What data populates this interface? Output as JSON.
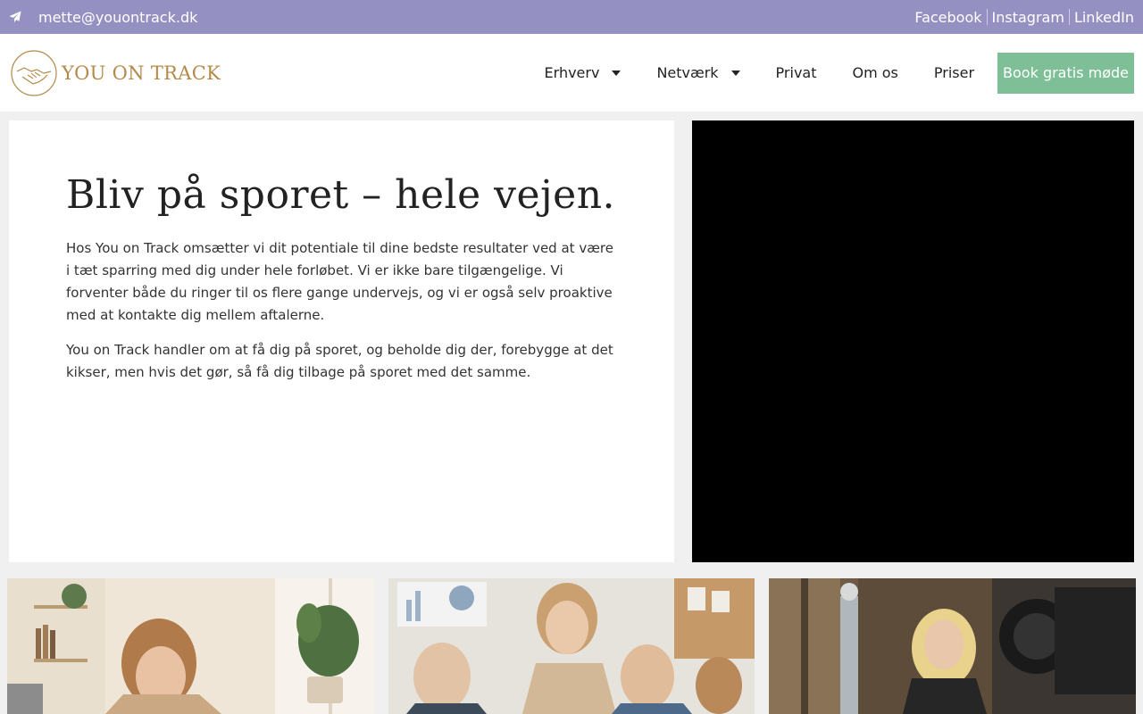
{
  "topbar": {
    "email": "mette@youontrack.dk",
    "socials": [
      "Facebook",
      "Instagram",
      "LinkedIn"
    ],
    "background": "#9590c2"
  },
  "logo": {
    "text": "YOU ON TRACK",
    "icon": "handshake-icon"
  },
  "nav": {
    "items": [
      {
        "label": "Erhverv",
        "dropdown": true
      },
      {
        "label": "Netværk",
        "dropdown": true
      },
      {
        "label": "Privat",
        "dropdown": false
      },
      {
        "label": "Om os",
        "dropdown": false
      },
      {
        "label": "Priser",
        "dropdown": false
      }
    ],
    "cta": "Book gratis møde",
    "cta_color": "#7fbf98"
  },
  "hero": {
    "title": "Bliv på sporet – hele vejen.",
    "paragraphs": [
      "Hos You on Track omsætter vi dit potentiale til dine bedste resultater ved at være i tæt sparring med dig under hele forløbet. Vi er ikke bare tilgængelige. Vi forventer både du ringer til os flere gange undervejs, og vi er også selv proaktive med at kontakte dig mellem aftalerne.",
      "You on Track handler om at få dig på sporet, og beholde dig der, forebygge at det kikser, men hvis det gør, så få dig tilbage på sporet med det samme."
    ]
  },
  "accent_colors": {
    "gold": "#b48a4a",
    "purple": "#9590c2",
    "green": "#7fbf98"
  }
}
